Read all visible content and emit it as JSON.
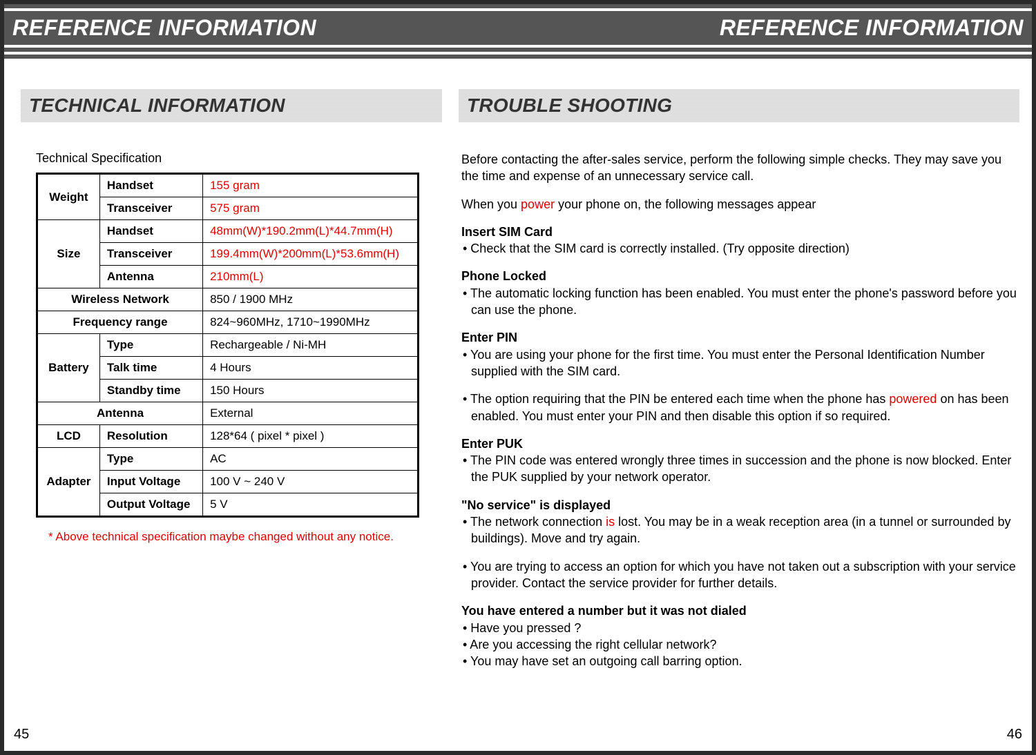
{
  "header": {
    "left": "REFERENCE INFORMATION",
    "right": "REFERENCE INFORMATION"
  },
  "leftCol": {
    "sectionTitle": "TECHNICAL INFORMATION",
    "caption": "Technical Specification",
    "table": {
      "weight": {
        "group": "Weight",
        "rows": [
          {
            "label": "Handset",
            "value": "155 gram",
            "red": true
          },
          {
            "label": "Transceiver",
            "value": "575 gram",
            "red": true
          }
        ]
      },
      "size": {
        "group": "Size",
        "rows": [
          {
            "label": "Handset",
            "value": "48mm(W)*190.2mm(L)*44.7mm(H)",
            "red": true
          },
          {
            "label": "Transceiver",
            "value": "199.4mm(W)*200mm(L)*53.6mm(H)",
            "red": true
          },
          {
            "label": "Antenna",
            "value": "210mm(L)",
            "red": true
          }
        ]
      },
      "wireless": {
        "label": "Wireless Network",
        "value": "850 / 1900 MHz"
      },
      "freq": {
        "label": "Frequency range",
        "value": "824~960MHz, 1710~1990MHz"
      },
      "battery": {
        "group": "Battery",
        "rows": [
          {
            "label": "Type",
            "value": "Rechargeable / Ni-MH"
          },
          {
            "label": "Talk time",
            "value": "4 Hours"
          },
          {
            "label": "Standby time",
            "value": "150 Hours"
          }
        ]
      },
      "antenna": {
        "label": "Antenna",
        "value": "External"
      },
      "lcd": {
        "group": "LCD",
        "label": "Resolution",
        "value": "128*64 ( pixel * pixel )"
      },
      "adapter": {
        "group": "Adapter",
        "rows": [
          {
            "label": "Type",
            "value": "AC"
          },
          {
            "label": "Input Voltage",
            "value": "100 V ~ 240 V"
          },
          {
            "label": "Output Voltage",
            "value": "5 V"
          }
        ]
      }
    },
    "footnote": "*  Above technical specification maybe changed without any notice."
  },
  "rightCol": {
    "sectionTitle": "TROUBLE SHOOTING",
    "intro1": "Before contacting the after-sales service, perform the  following simple checks. They may save you the time and expense of an unnecessary service call.",
    "intro2a": "When you ",
    "intro2b": "power",
    "intro2c": " your phone on, the following messages appear",
    "blocks": {
      "insertSim": {
        "head": "Insert SIM Card",
        "b1": "• Check that the SIM card is correctly installed. (Try opposite direction)"
      },
      "phoneLocked": {
        "head": "Phone Locked",
        "b1": "• The automatic locking function has been enabled. You must enter the phone's password before you can use the phone."
      },
      "enterPin": {
        "head": "Enter PIN",
        "b1": "• You are using your phone for the first time. You must enter the Personal Identification Number supplied with the SIM card.",
        "b2a": "• The option requiring that the PIN be entered each time when the phone has ",
        "b2b": "powered",
        "b2c": " on has been enabled. You must enter your PIN and then disable this option if so required."
      },
      "enterPuk": {
        "head": "Enter PUK",
        "b1": "• The PIN code was entered wrongly three times in succession and the phone is now blocked. Enter the PUK supplied by your network operator."
      },
      "noService": {
        "head": "\"No service\" is displayed",
        "b1a": "• The network connection ",
        "b1b": "is",
        "b1c": " lost. You may be in a weak reception area (in a tunnel or surrounded by buildings). Move and try again.",
        "b2": "• You are trying to access an option for which you have not taken out a subscription with your service provider. Contact the service provider for further details."
      },
      "notDialed": {
        "head": "You have entered a number but it was not dialed",
        "b1": "• Have you pressed ?",
        "b2": "• Are you accessing the right cellular network?",
        "b3": "• You may have set an outgoing call barring option."
      }
    }
  },
  "pages": {
    "left": "45",
    "right": "46"
  }
}
